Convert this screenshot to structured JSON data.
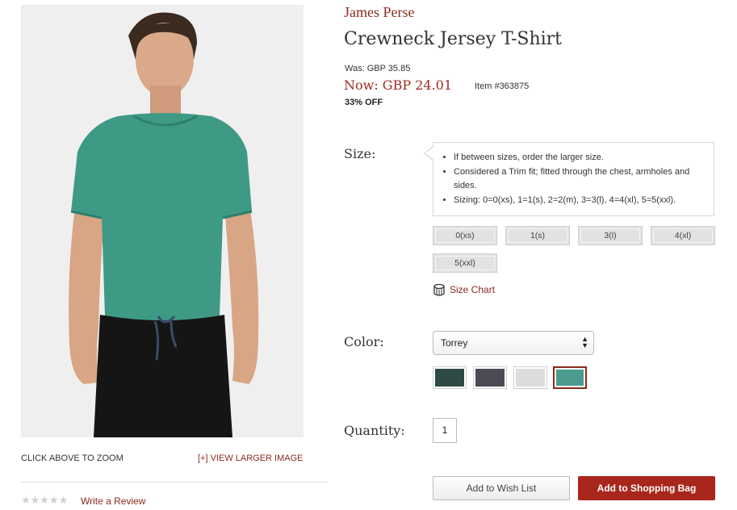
{
  "product": {
    "brand": "James Perse",
    "title": "Crewneck Jersey T-Shirt",
    "was_price": "Was: GBP 35.85",
    "now_price": "Now: GBP 24.01",
    "item_number": "Item #363875",
    "discount": "33% OFF"
  },
  "image_panel": {
    "zoom_hint": "CLICK ABOVE TO ZOOM",
    "view_larger": "[+] VIEW LARGER IMAGE",
    "rating_stars": "★★★★★",
    "rating_value": 0,
    "write_review": "Write a Review"
  },
  "size": {
    "label": "Size:",
    "notes": [
      "If between sizes, order the larger size.",
      "Considered a Trim fit; fitted through the chest, armholes and sides.",
      "Sizing: 0=0(xs), 1=1(s), 2=2(m), 3=3(l), 4=4(xl), 5=5(xxl)."
    ],
    "options": [
      "0(xs)",
      "1(s)",
      "3(l)",
      "4(xl)",
      "5(xxl)"
    ],
    "chart_link": "Size Chart"
  },
  "color": {
    "label": "Color:",
    "selected": "Torrey",
    "swatches": [
      {
        "name": "dark-green",
        "hex": "#2f4a44"
      },
      {
        "name": "charcoal",
        "hex": "#4a4b55"
      },
      {
        "name": "light-grey",
        "hex": "#dcdcdc"
      },
      {
        "name": "torrey",
        "hex": "#4a9a8e",
        "selected": true
      }
    ]
  },
  "quantity": {
    "label": "Quantity:",
    "value": "1"
  },
  "actions": {
    "wish_list": "Add to Wish List",
    "shopping_bag": "Add to Shopping Bag"
  },
  "colors": {
    "accent": "#8b2a1e",
    "button_primary": "#a8261c",
    "shirt": "#3e9a85",
    "pants": "#151515"
  }
}
